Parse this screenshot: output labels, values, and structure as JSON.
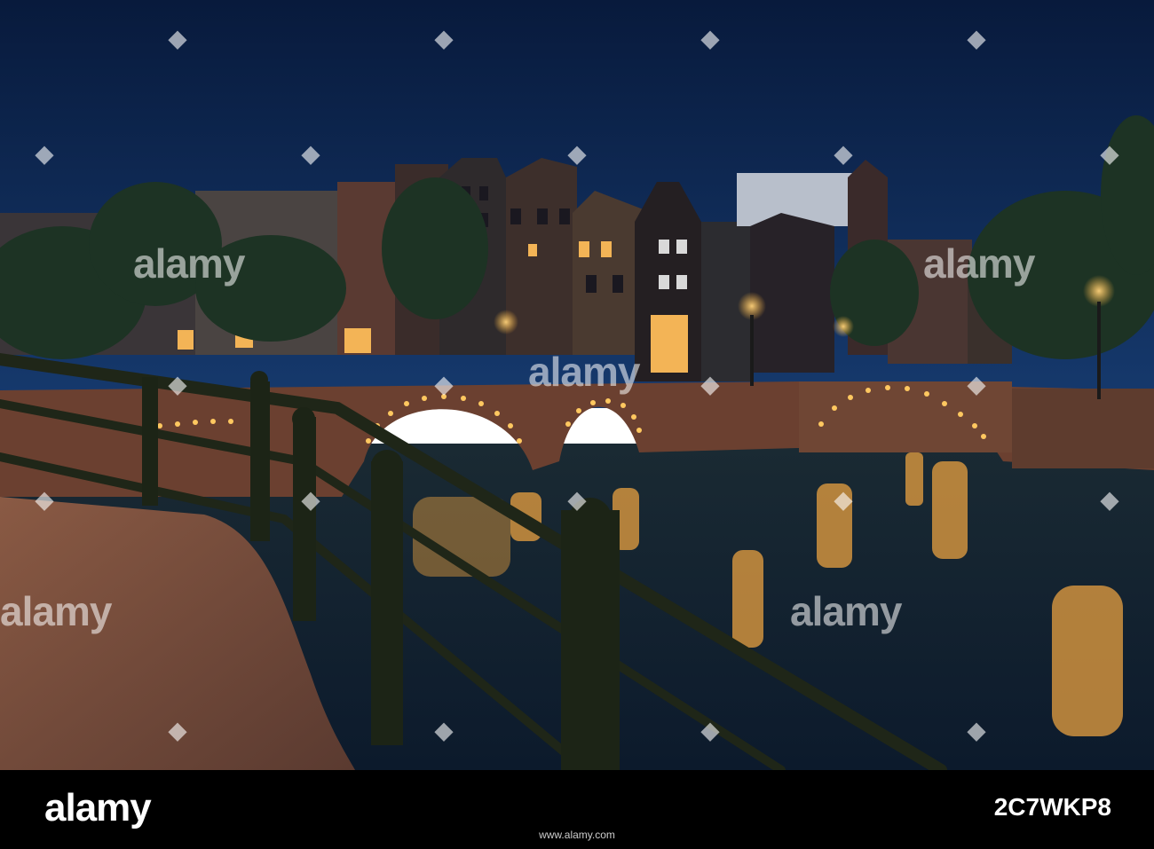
{
  "watermark": {
    "brand": "alamy",
    "diamond": "◆"
  },
  "footer": {
    "logo": "alamy",
    "image_id": "2C7WKP8",
    "url": "www.alamy.com"
  },
  "colors": {
    "sky": "#0b2146",
    "water": "#0f1d2a",
    "lamp": "#ffb43a",
    "brick": "#6b4030",
    "footer_bg": "#000000"
  }
}
